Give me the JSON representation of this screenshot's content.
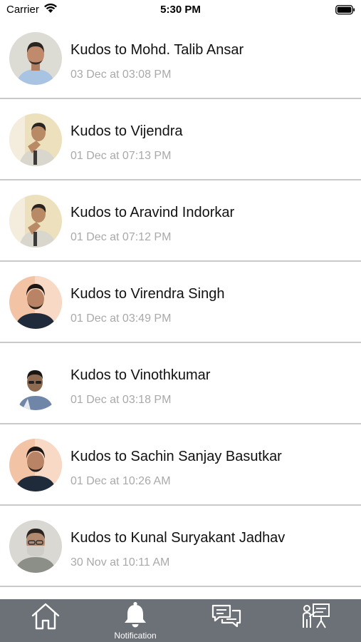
{
  "status_bar": {
    "carrier": "Carrier",
    "time": "5:30 PM"
  },
  "notifications": [
    {
      "title": "Kudos to Mohd. Talib Ansar",
      "timestamp": "03 Dec at 03:08 PM",
      "avatar_style": "a"
    },
    {
      "title": "Kudos to Vijendra",
      "timestamp": "01 Dec at 07:13 PM",
      "avatar_style": "b"
    },
    {
      "title": "Kudos to Aravind Indorkar",
      "timestamp": "01 Dec at 07:12 PM",
      "avatar_style": "b"
    },
    {
      "title": "Kudos to Virendra Singh",
      "timestamp": "01 Dec at 03:49 PM",
      "avatar_style": "c"
    },
    {
      "title": "Kudos to Vinothkumar",
      "timestamp": "01 Dec at 03:18 PM",
      "avatar_style": "d"
    },
    {
      "title": "Kudos to Sachin Sanjay Basutkar",
      "timestamp": "01 Dec at 10:26 AM",
      "avatar_style": "c"
    },
    {
      "title": "Kudos to Kunal Suryakant Jadhav",
      "timestamp": "30 Nov at 10:11 AM",
      "avatar_style": "e"
    }
  ],
  "tab_bar": {
    "tabs": [
      {
        "icon": "home-icon",
        "label": ""
      },
      {
        "icon": "bell-icon",
        "label": "Notification",
        "active": true
      },
      {
        "icon": "chat-icon",
        "label": ""
      },
      {
        "icon": "presentation-icon",
        "label": ""
      }
    ],
    "background": "#6c7077"
  }
}
